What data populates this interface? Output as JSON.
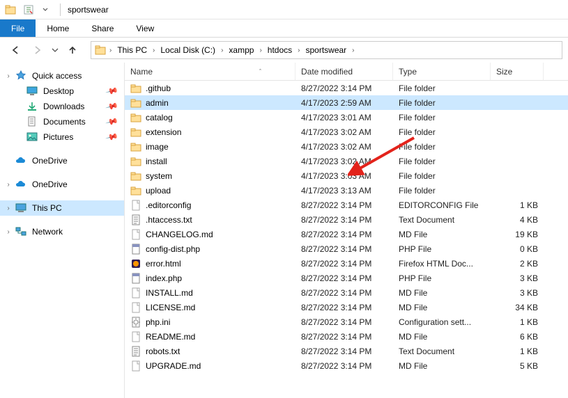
{
  "titlebar": {
    "title": "sportswear"
  },
  "ribbon": {
    "file": "File",
    "home": "Home",
    "share": "Share",
    "view": "View"
  },
  "breadcrumb": {
    "items": [
      "This PC",
      "Local Disk (C:)",
      "xampp",
      "htdocs",
      "sportswear"
    ]
  },
  "sidebar": {
    "quick_access": "Quick access",
    "desktop": "Desktop",
    "downloads": "Downloads",
    "documents": "Documents",
    "pictures": "Pictures",
    "onedrive1": "OneDrive",
    "onedrive2": "OneDrive",
    "this_pc": "This PC",
    "network": "Network"
  },
  "columns": {
    "name": "Name",
    "date": "Date modified",
    "type": "Type",
    "size": "Size"
  },
  "rows": [
    {
      "icon": "folder",
      "name": ".github",
      "date": "8/27/2022 3:14 PM",
      "type": "File folder",
      "size": ""
    },
    {
      "icon": "folder",
      "name": "admin",
      "date": "4/17/2023 2:59 AM",
      "type": "File folder",
      "size": "",
      "selected": true
    },
    {
      "icon": "folder",
      "name": "catalog",
      "date": "4/17/2023 3:01 AM",
      "type": "File folder",
      "size": ""
    },
    {
      "icon": "folder",
      "name": "extension",
      "date": "4/17/2023 3:02 AM",
      "type": "File folder",
      "size": ""
    },
    {
      "icon": "folder",
      "name": "image",
      "date": "4/17/2023 3:02 AM",
      "type": "File folder",
      "size": ""
    },
    {
      "icon": "folder",
      "name": "install",
      "date": "4/17/2023 3:02 AM",
      "type": "File folder",
      "size": ""
    },
    {
      "icon": "folder",
      "name": "system",
      "date": "4/17/2023 3:03 AM",
      "type": "File folder",
      "size": ""
    },
    {
      "icon": "folder",
      "name": "upload",
      "date": "4/17/2023 3:13 AM",
      "type": "File folder",
      "size": ""
    },
    {
      "icon": "file",
      "name": ".editorconfig",
      "date": "8/27/2022 3:14 PM",
      "type": "EDITORCONFIG File",
      "size": "1 KB"
    },
    {
      "icon": "text",
      "name": ".htaccess.txt",
      "date": "8/27/2022 3:14 PM",
      "type": "Text Document",
      "size": "4 KB"
    },
    {
      "icon": "file",
      "name": "CHANGELOG.md",
      "date": "8/27/2022 3:14 PM",
      "type": "MD File",
      "size": "19 KB"
    },
    {
      "icon": "php",
      "name": "config-dist.php",
      "date": "8/27/2022 3:14 PM",
      "type": "PHP File",
      "size": "0 KB"
    },
    {
      "icon": "ff",
      "name": "error.html",
      "date": "8/27/2022 3:14 PM",
      "type": "Firefox HTML Doc...",
      "size": "2 KB"
    },
    {
      "icon": "php",
      "name": "index.php",
      "date": "8/27/2022 3:14 PM",
      "type": "PHP File",
      "size": "3 KB"
    },
    {
      "icon": "file",
      "name": "INSTALL.md",
      "date": "8/27/2022 3:14 PM",
      "type": "MD File",
      "size": "3 KB"
    },
    {
      "icon": "file",
      "name": "LICENSE.md",
      "date": "8/27/2022 3:14 PM",
      "type": "MD File",
      "size": "34 KB"
    },
    {
      "icon": "ini",
      "name": "php.ini",
      "date": "8/27/2022 3:14 PM",
      "type": "Configuration sett...",
      "size": "1 KB"
    },
    {
      "icon": "file",
      "name": "README.md",
      "date": "8/27/2022 3:14 PM",
      "type": "MD File",
      "size": "6 KB"
    },
    {
      "icon": "text",
      "name": "robots.txt",
      "date": "8/27/2022 3:14 PM",
      "type": "Text Document",
      "size": "1 KB"
    },
    {
      "icon": "file",
      "name": "UPGRADE.md",
      "date": "8/27/2022 3:14 PM",
      "type": "MD File",
      "size": "5 KB"
    }
  ]
}
